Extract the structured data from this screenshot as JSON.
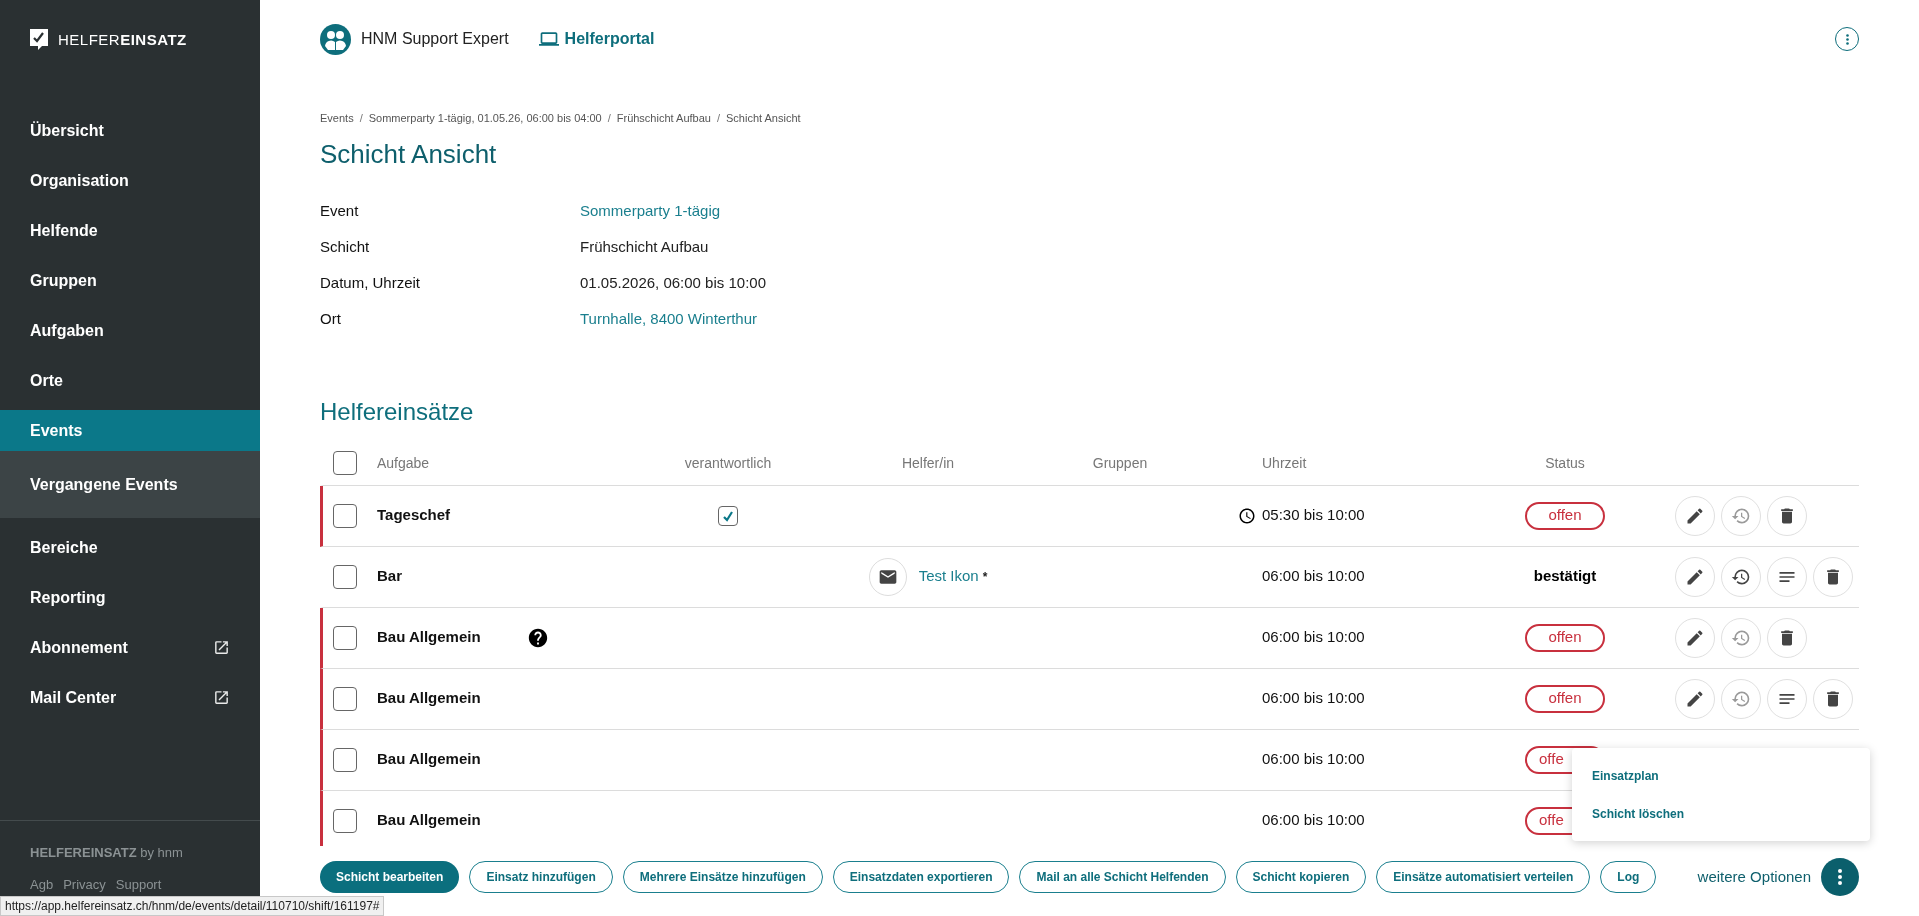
{
  "sidebar": {
    "logo": "HELFER**EINSATZ**",
    "items": [
      {
        "label": "Übersicht",
        "selected": false,
        "external": false
      },
      {
        "label": "Organisation",
        "selected": false,
        "external": false
      },
      {
        "label": "Helfende",
        "selected": false,
        "external": false
      },
      {
        "label": "Gruppen",
        "selected": false,
        "external": false
      },
      {
        "label": "Aufgaben",
        "selected": false,
        "external": false
      },
      {
        "label": "Orte",
        "selected": false,
        "external": false
      },
      {
        "label": "Events",
        "selected": true,
        "external": false,
        "children": [
          {
            "label": "Vergangene Events",
            "selected": false,
            "external": false
          }
        ]
      },
      {
        "label": "Bereiche",
        "selected": false,
        "external": false
      },
      {
        "label": "Reporting",
        "selected": false,
        "external": false
      },
      {
        "label": "Abonnement",
        "selected": false,
        "external": true
      },
      {
        "label": "Mail Center",
        "selected": false,
        "external": true
      }
    ],
    "footer": "**HELFEREINSATZ** by hnm",
    "footer_links": [
      "Agb",
      "Privacy",
      "Support"
    ]
  },
  "header": {
    "user": "HNM Support Expert",
    "portal": "Helferportal"
  },
  "breadcrumb": [
    "Events",
    "Sommerparty 1-tägig, 01.05.26, 06:00 bis 04:00",
    "Frühschicht Aufbau",
    "Schicht Ansicht"
  ],
  "breadcrumb_separator": "/",
  "title": "Schicht Ansicht",
  "details": [
    {
      "label": "Event",
      "value": "Sommerparty 1-tägig",
      "link": true
    },
    {
      "label": "Schicht",
      "value": "Frühschicht Aufbau",
      "link": false
    },
    {
      "label": "Datum, Uhrzeit",
      "value": "01.05.2026, 06:00 bis 10:00",
      "link": false
    },
    {
      "label": "Ort",
      "value": "Turnhalle, 8400 Winterthur",
      "link": true
    }
  ],
  "section_title": "Helfereinsätze",
  "table": {
    "all_checked": false,
    "columns": [
      "Aufgabe",
      "verantwortlich",
      "Helfer/in",
      "Gruppen",
      "Uhrzeit",
      "Status"
    ],
    "rows": [
      {
        "task": "Tageschef",
        "kind": "open",
        "checked": false,
        "responsible": true,
        "hint": false,
        "clock": true,
        "time": "05:30 bis 10:00",
        "status": "offen",
        "actions": [
          {
            "kind": "edit",
            "disabled": false
          },
          {
            "kind": "reset",
            "disabled": true
          },
          {
            "kind": "delete",
            "disabled": false
          }
        ]
      },
      {
        "task": "Bar",
        "kind": "confirmed",
        "checked": false,
        "responsible": false,
        "hint": false,
        "clock": false,
        "helper": {
          "name": "Test Ikon",
          "mark": "*"
        },
        "time": "06:00 bis 10:00",
        "status": "bestätigt",
        "actions": [
          {
            "kind": "edit",
            "disabled": false
          },
          {
            "kind": "reset",
            "disabled": false
          },
          {
            "kind": "notes",
            "disabled": false
          },
          {
            "kind": "delete",
            "disabled": false
          }
        ]
      },
      {
        "task": "Bau Allgemein",
        "kind": "open",
        "checked": false,
        "responsible": false,
        "hint": true,
        "clock": false,
        "time": "06:00 bis 10:00",
        "status": "offen",
        "actions": [
          {
            "kind": "edit",
            "disabled": false
          },
          {
            "kind": "reset",
            "disabled": true
          },
          {
            "kind": "delete",
            "disabled": false
          }
        ]
      },
      {
        "task": "Bau Allgemein",
        "kind": "open",
        "checked": false,
        "responsible": false,
        "hint": false,
        "clock": false,
        "time": "06:00 bis 10:00",
        "status": "offen",
        "actions": [
          {
            "kind": "edit",
            "disabled": false
          },
          {
            "kind": "reset",
            "disabled": true
          },
          {
            "kind": "notes",
            "disabled": false
          },
          {
            "kind": "delete",
            "disabled": false
          }
        ]
      },
      {
        "task": "Bau Allgemein",
        "kind": "open",
        "checked": false,
        "responsible": false,
        "hint": false,
        "clock": false,
        "time": "06:00 bis 10:00",
        "status": "offe"
      },
      {
        "task": "Bau Allgemein",
        "kind": "open",
        "checked": false,
        "responsible": false,
        "hint": false,
        "clock": false,
        "time": "06:00 bis 10:00",
        "status": "offe"
      }
    ]
  },
  "actions": [
    {
      "label": "Schicht bearbeiten",
      "primary": true
    },
    {
      "label": "Einsatz hinzufügen",
      "primary": false
    },
    {
      "label": "Mehrere Einsätze hinzufügen",
      "primary": false
    },
    {
      "label": "Einsatzdaten exportieren",
      "primary": false
    },
    {
      "label": "Mail an alle Schicht Helfenden",
      "primary": false
    },
    {
      "label": "Schicht kopieren",
      "primary": false
    },
    {
      "label": "Einsätze automatisiert verteilen",
      "primary": false
    },
    {
      "label": "Log",
      "primary": false
    }
  ],
  "more_label": "weitere Optionen",
  "menu": [
    "Einsatzplan",
    "Schicht löschen"
  ],
  "status_url": "https://app.helfereinsatz.ch/hnm/de/events/detail/110710/shift/161197#"
}
